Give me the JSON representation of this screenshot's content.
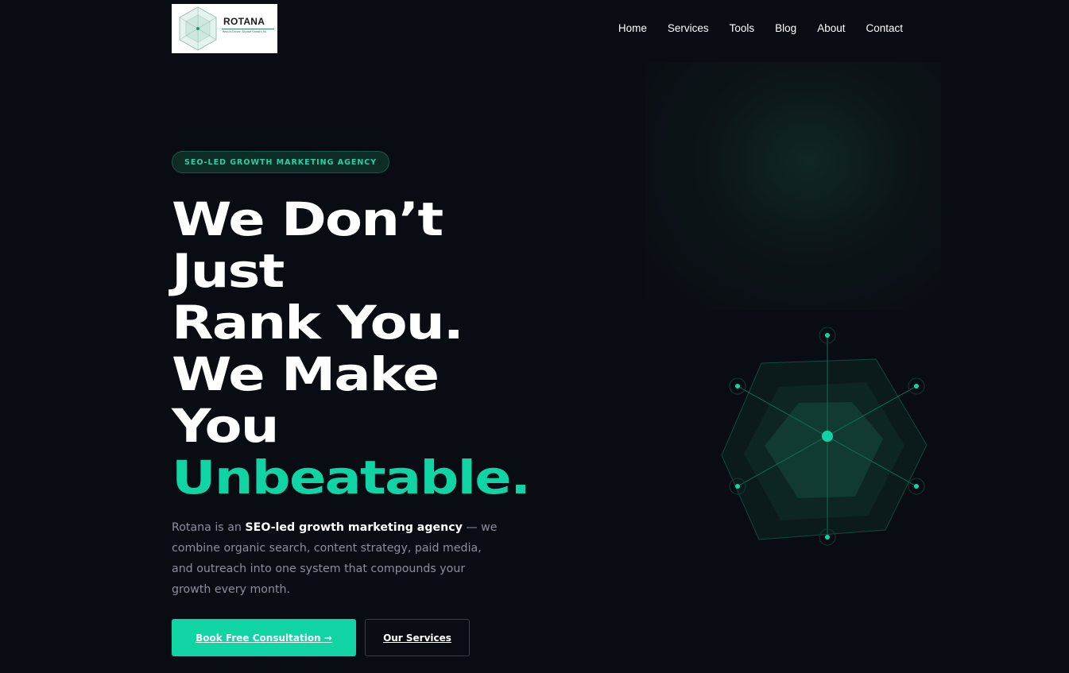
{
  "logo": {
    "name": "ROTANA",
    "tagline": "Result-Driven Digital Growth Marketing Agency"
  },
  "nav": {
    "items": [
      "Home",
      "Services",
      "Tools",
      "Blog",
      "About",
      "Contact"
    ]
  },
  "hero": {
    "badge": "SEO-LED GROWTH MARKETING AGENCY",
    "headline_lines": [
      "We Don’t",
      "Just",
      "Rank You.",
      "We Make",
      "You"
    ],
    "headline_accent": "Unbeatable.",
    "description_prefix": "Rotana is an ",
    "description_bold": "SEO-led growth marketing agency",
    "description_suffix": " — we combine organic search, content strategy, paid media, and outreach into one system that compounds your growth every month.",
    "primary_button": "Book Free Consultation →",
    "secondary_button": "Our Services"
  },
  "colors": {
    "accent": "#10d4a4",
    "background": "#0a0c13",
    "badge_bg": "#0e2b26",
    "muted_text": "#8a8f9e"
  },
  "icons": {
    "logo_mark": "hexagon-network-icon",
    "hero_graphic": "hexagon-network-icon"
  }
}
